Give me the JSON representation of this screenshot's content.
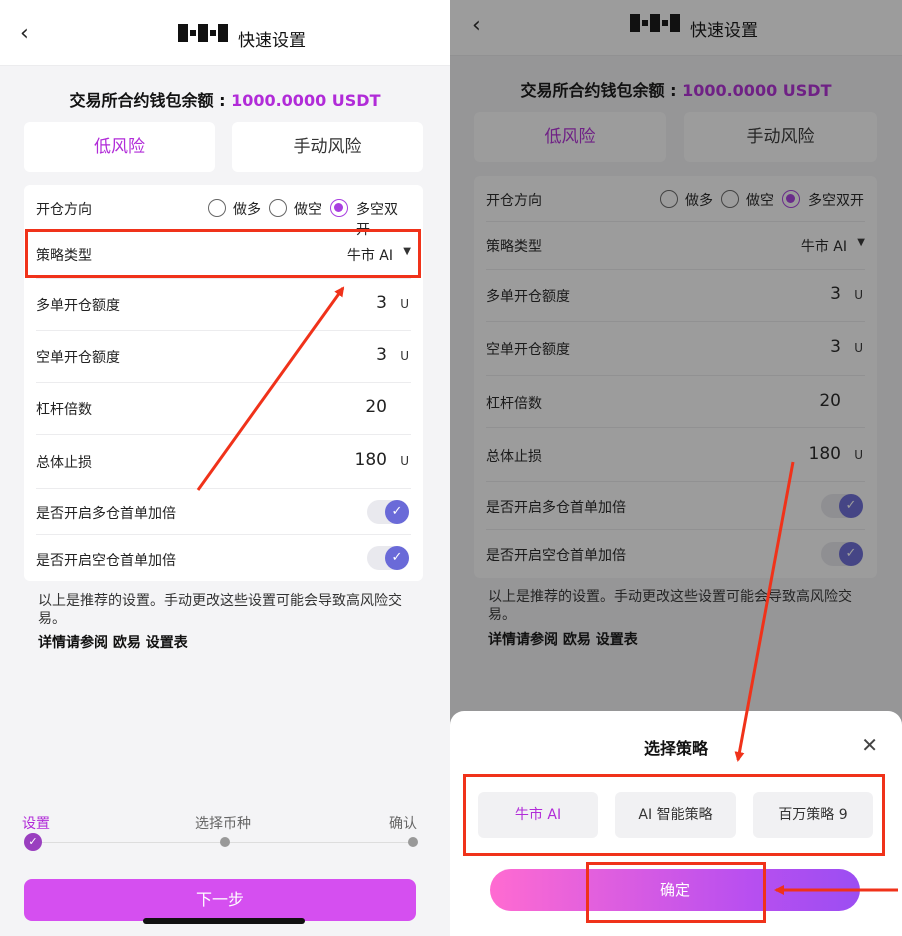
{
  "app": {
    "logo": "OKX",
    "title": "快速设置"
  },
  "balance": {
    "label": "交易所合约钱包余额 :",
    "value": "1000.0000 USDT"
  },
  "tabs": [
    "低风险",
    "手动风险"
  ],
  "direction": {
    "label": "开仓方向",
    "options": [
      "做多",
      "做空",
      "多空双开"
    ],
    "selected": "多空双开"
  },
  "strategy": {
    "label": "策略类型",
    "value": "牛市 AI"
  },
  "rows": [
    {
      "label": "多单开仓额度",
      "value": "3",
      "unit": "U"
    },
    {
      "label": "空单开仓额度",
      "value": "3",
      "unit": "U"
    },
    {
      "label": "杠杆倍数",
      "value": "20",
      "unit": ""
    },
    {
      "label": "总体止损",
      "value": "180",
      "unit": "U"
    }
  ],
  "toggles": [
    {
      "label": "是否开启多仓首单加倍",
      "on": true
    },
    {
      "label": "是否开启空仓首单加倍",
      "on": true
    }
  ],
  "note": "以上是推荐的设置。手动更改这些设置可能会导致高风险交易。",
  "link": "详情请参阅 欧易 设置表",
  "steps": [
    "设置",
    "选择币种",
    "确认"
  ],
  "next_label": "下一步",
  "sheet": {
    "title": "选择策略",
    "options": [
      "牛市 AI",
      "AI 智能策略",
      "百万策略 9"
    ],
    "selected": "牛市 AI",
    "confirm_label": "确定"
  },
  "colors": {
    "accent": "#b12bd8",
    "annotation": "#f0321a"
  }
}
